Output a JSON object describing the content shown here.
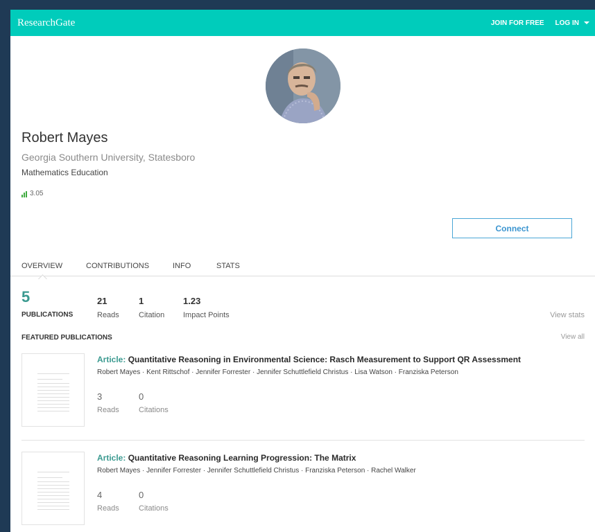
{
  "brand": "ResearchGate",
  "header": {
    "join_label": "JOIN FOR FREE",
    "login_label": "LOG IN"
  },
  "profile": {
    "name": "Robert Mayes",
    "institution": "Georgia Southern University, Statesboro",
    "department": "Mathematics Education",
    "score": "3.05",
    "connect_label": "Connect"
  },
  "tabs": [
    "OVERVIEW",
    "CONTRIBUTIONS",
    "INFO",
    "STATS"
  ],
  "stats": {
    "publications": "5",
    "publications_label": "PUBLICATIONS",
    "reads": "21",
    "reads_label": "Reads",
    "citation": "1",
    "citation_label": "Citation",
    "impact": "1.23",
    "impact_label": "Impact Points",
    "view_stats": "View stats"
  },
  "featured": {
    "title": "FEATURED PUBLICATIONS",
    "view_all": "View all",
    "items": [
      {
        "type": "Article:",
        "title": "Quantitative Reasoning in Environmental Science: Rasch Measurement to Support QR Assessment",
        "authors": "Robert Mayes · Kent Rittschof · Jennifer Forrester · Jennifer Schuttlefield Christus · Lisa Watson · Franziska Peterson",
        "reads": "3",
        "reads_label": "Reads",
        "citations": "0",
        "citations_label": "Citations"
      },
      {
        "type": "Article:",
        "title": "Quantitative Reasoning Learning Progression: The Matrix",
        "authors": "Robert Mayes · Jennifer Forrester · Jennifer Schuttlefield Christus · Franziska Peterson · Rachel Walker",
        "reads": "4",
        "reads_label": "Reads",
        "citations": "0",
        "citations_label": "Citations"
      }
    ]
  },
  "colors": {
    "brand_teal": "#00ccbb",
    "accent_teal": "#3b9a90",
    "connect_blue": "#3b95d0",
    "outer_bg": "#1f3a55"
  }
}
